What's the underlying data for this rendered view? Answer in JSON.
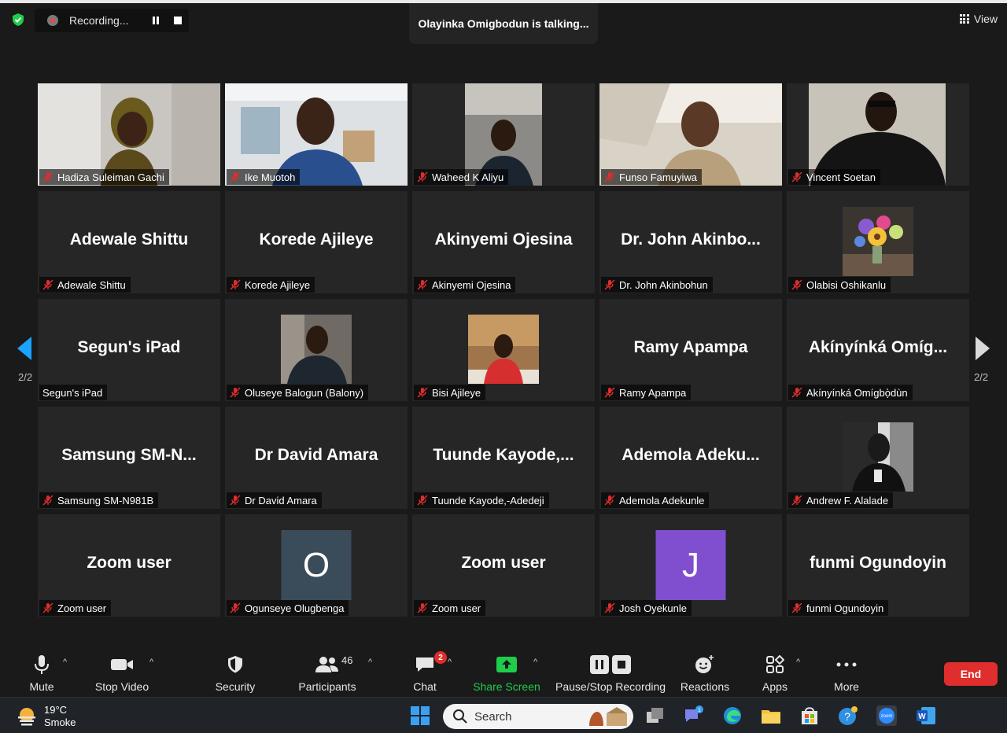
{
  "recording": {
    "label": "Recording..."
  },
  "talking": {
    "text": "Olayinka Omigbodun is talking..."
  },
  "view": {
    "label": "View"
  },
  "colors": {
    "accent_green": "#1fcc4b",
    "end_red": "#e02d2d",
    "arrow_blue": "#1aa3ff",
    "tile_bg": "#262626"
  },
  "tiles": [
    {
      "name": "Hadiza Suleiman Gachi",
      "type": "video"
    },
    {
      "name": "Ike Muotoh",
      "type": "video"
    },
    {
      "name": "Waheed K Aliyu",
      "type": "video"
    },
    {
      "name": "Funso Famuyiwa",
      "type": "video"
    },
    {
      "name": "Vincent Soetan",
      "type": "video"
    },
    {
      "name": "Adewale Shittu",
      "display": "Adewale Shittu",
      "type": "name"
    },
    {
      "name": "Korede Ajileye",
      "display": "Korede Ajileye",
      "type": "name"
    },
    {
      "name": "Akinyemi Ojesina",
      "display": "Akinyemi Ojesina",
      "type": "name"
    },
    {
      "name": "Dr. John Akinbohun",
      "display": "Dr. John  Akinbo...",
      "type": "name"
    },
    {
      "name": "Olabisi Oshikanlu",
      "type": "photo",
      "photo": "flowers"
    },
    {
      "name": "Segun's iPad",
      "display": "Segun's iPad",
      "type": "name",
      "muted": false
    },
    {
      "name": "Oluseye Balogun (Balony)",
      "type": "photo",
      "photo": "man-suit"
    },
    {
      "name": "Bisi Ajileye",
      "type": "photo",
      "photo": "woman-red"
    },
    {
      "name": "Ramy Apampa",
      "display": "Ramy Apampa",
      "type": "name"
    },
    {
      "name": "Akínyínká Omígbọ̀dùn",
      "display": "Akínyínká  Omíg...",
      "type": "name"
    },
    {
      "name": "Samsung SM-N981B",
      "display": "Samsung  SM-N...",
      "type": "name"
    },
    {
      "name": "Dr David Amara",
      "display": "Dr David Amara",
      "type": "name"
    },
    {
      "name": "Tuunde Kayode,-Adedeji",
      "display": "Tuunde  Kayode,...",
      "type": "name"
    },
    {
      "name": "Ademola Adekunle",
      "display": "Ademola  Adeku...",
      "type": "name"
    },
    {
      "name": "Andrew F. Alalade",
      "type": "photo",
      "photo": "man-bw"
    },
    {
      "name": "Zoom user",
      "display": "Zoom user",
      "type": "name"
    },
    {
      "name": "Ogunseye Olugbenga",
      "type": "letter",
      "letter": "O",
      "color": "#3a4c5a"
    },
    {
      "name": "Zoom user",
      "display": "Zoom user",
      "type": "name"
    },
    {
      "name": "Josh Oyekunle",
      "type": "letter",
      "letter": "J",
      "color": "#7f4fcf"
    },
    {
      "name": "funmi Ogundoyin",
      "display": "funmi Ogundoyin",
      "type": "name"
    }
  ],
  "pagination": {
    "left": "2/2",
    "right": "2/2"
  },
  "toolbar": {
    "mute": "Mute",
    "stop_video": "Stop Video",
    "security": "Security",
    "participants": "Participants",
    "participants_count": "46",
    "chat": "Chat",
    "chat_badge": "2",
    "share_screen": "Share Screen",
    "pause_stop_recording": "Pause/Stop Recording",
    "reactions": "Reactions",
    "apps": "Apps",
    "more": "More",
    "end": "End"
  },
  "taskbar": {
    "temperature": "19°C",
    "weather": "Smoke",
    "search_placeholder": "Search",
    "teams_badge": "1"
  }
}
